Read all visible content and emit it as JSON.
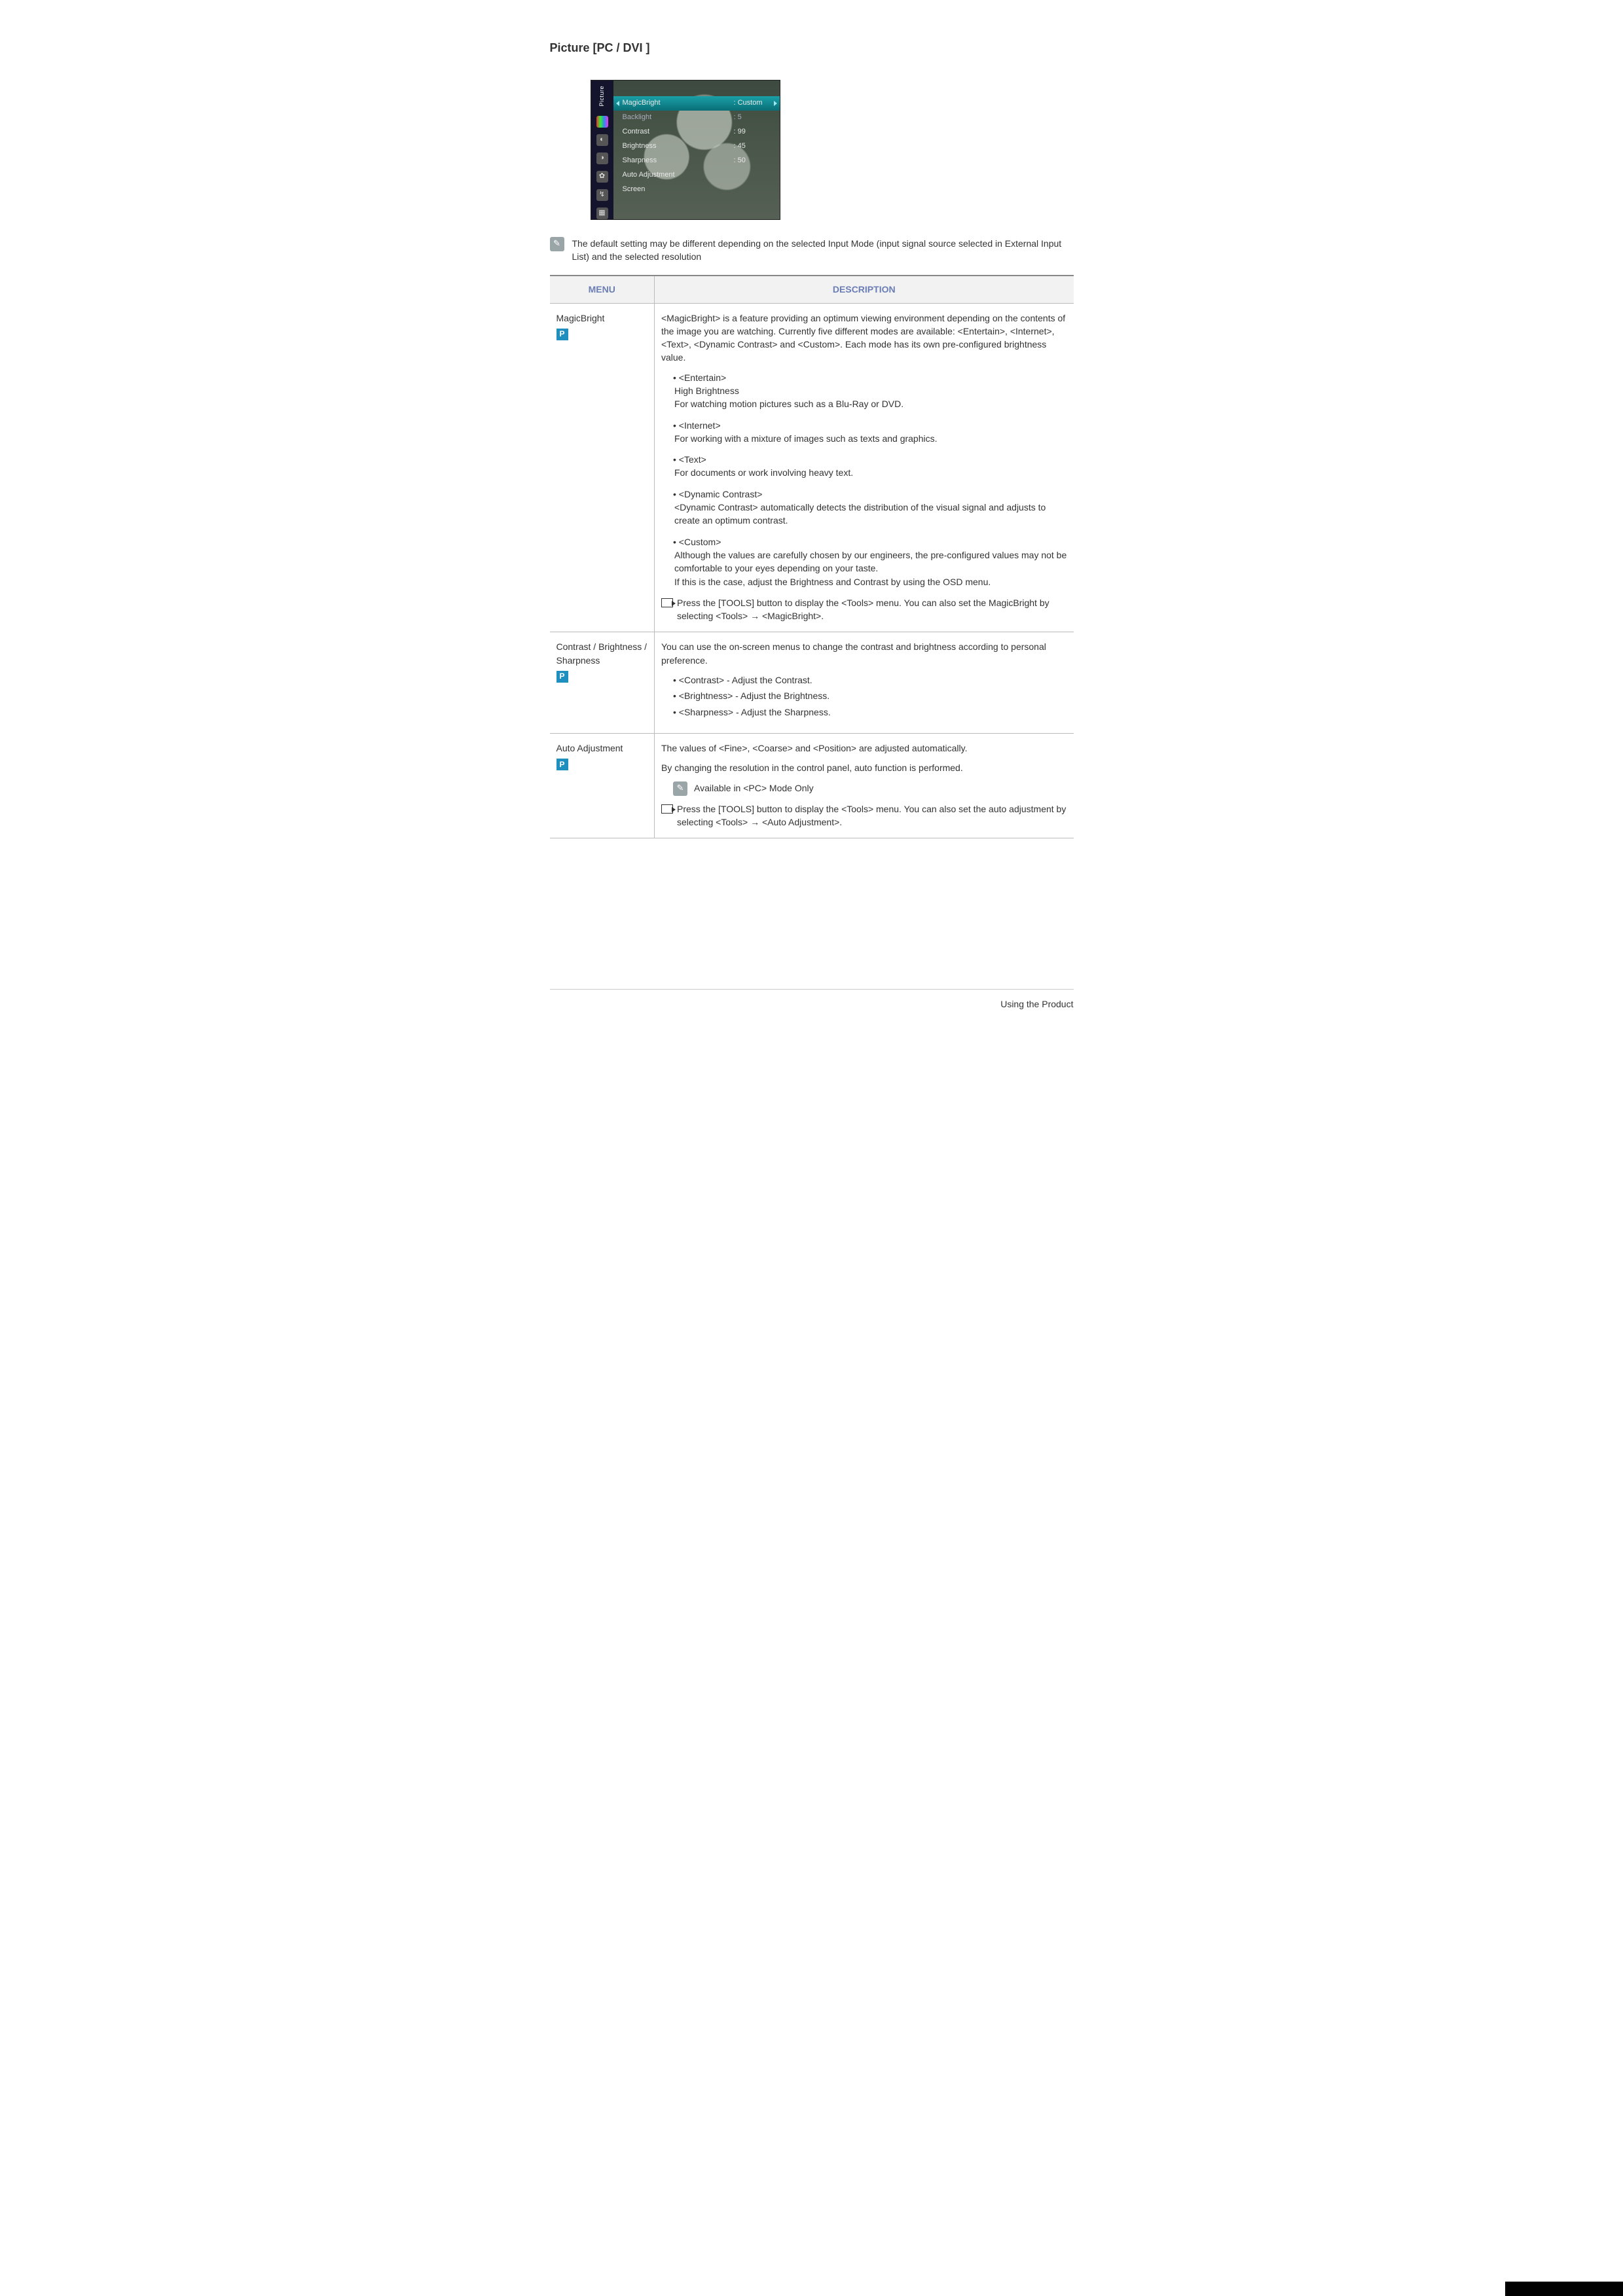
{
  "title": "Picture [PC / DVI ]",
  "osd": {
    "side_label": "Picture",
    "rows": [
      {
        "label": "MagicBright",
        "value": ": Custom",
        "selected": true
      },
      {
        "label": "Backlight",
        "value": ": 5",
        "dim": true
      },
      {
        "label": "Contrast",
        "value": ": 99"
      },
      {
        "label": "Brightness",
        "value": ": 45"
      },
      {
        "label": "Sharpness",
        "value": ": 50"
      },
      {
        "label": "Auto Adjustment",
        "value": ""
      },
      {
        "label": "Screen",
        "value": ""
      }
    ]
  },
  "top_note": "The default setting may be different depending on the selected Input Mode (input signal source selected in External Input List) and the selected resolution",
  "table": {
    "head_menu": "MENU",
    "head_desc": "DESCRIPTION"
  },
  "row1": {
    "menu": "MagicBright",
    "badge": "P",
    "intro": "<MagicBright> is a feature providing an optimum viewing environment depending on the contents of the image you are watching. Currently five different modes are available: <Entertain>, <Internet>, <Text>, <Dynamic Contrast> and <Custom>. Each mode has its own pre-configured brightness value.",
    "m1_label": "<Entertain>",
    "m1_line1": "High Brightness",
    "m1_line2": "For watching motion pictures such as a Blu-Ray or DVD.",
    "m2_label": "<Internet>",
    "m2_text": "For working with a mixture of images such as texts and graphics.",
    "m3_label": "<Text>",
    "m3_text": "For documents or work involving heavy text.",
    "m4_label": "<Dynamic Contrast>",
    "m4_text": "<Dynamic Contrast> automatically detects the distribution of the visual signal and adjusts to create an optimum contrast.",
    "m5_label": "<Custom>",
    "m5_text1": "Although the values are carefully chosen by our engineers, the pre-configured values may not be comfortable to your eyes depending on your taste.",
    "m5_text2": "If this is the case, adjust the Brightness and Contrast by using the OSD menu.",
    "tools": "Press the [TOOLS] button to display the <Tools> menu. You can also set the MagicBright by selecting <Tools> → <MagicBright>."
  },
  "row2": {
    "menu": "Contrast / Brightness / Sharpness",
    "badge": "P",
    "intro": "You can use the on-screen menus to change the contrast and brightness according to personal preference.",
    "li1": "<Contrast> - Adjust the Contrast.",
    "li2": "<Brightness> - Adjust the Brightness.",
    "li3": "<Sharpness> - Adjust the Sharpness."
  },
  "row3": {
    "menu": "Auto Adjustment",
    "badge": "P",
    "line1": "The values of <Fine>, <Coarse> and <Position> are adjusted automatically.",
    "line2": "By changing the resolution in the control panel, auto function is performed.",
    "note": "Available in <PC> Mode Only",
    "tools": "Press the [TOOLS] button to display the <Tools> menu. You can also set the auto adjustment by selecting <Tools> → <Auto Adjustment>."
  },
  "footer": "Using the Product"
}
